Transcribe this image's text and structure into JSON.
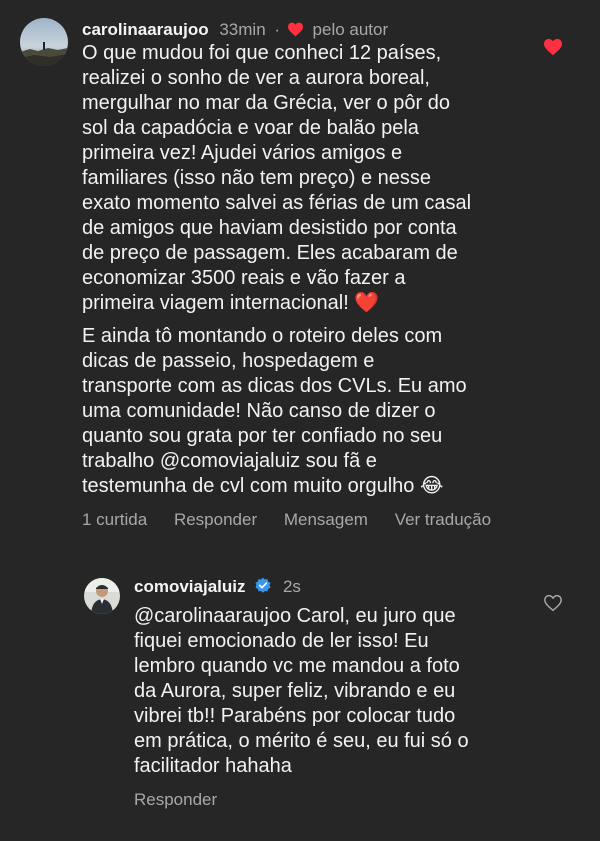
{
  "comment": {
    "username": "carolinaaraujoo",
    "time": "33min",
    "separator": "·",
    "liked_by_author": "pelo autor",
    "paragraph_1": "O que mudou foi que conheci 12 países,\nrealizei o sonho de ver a aurora boreal,\nmergulhar no mar da Grécia, ver o pôr do\nsol da capadócia e voar de balão pela\nprimeira vez! Ajudei vários amigos e\nfamiliares (isso não tem preço) e nesse\nexato momento salvei as férias de um casal\nde amigos que haviam desistido por conta\nde preço de passagem. Eles acabaram de\neconomizar 3500 reais e vão fazer a\nprimeira viagem internacional! ❤️",
    "paragraph_2": "E ainda tô montando o roteiro deles com\ndicas de passeio, hospedagem e\ntransporte com as dicas dos CVLs. Eu amo\numa comunidade! Não canso de dizer o\nquanto sou grata por ter confiado no seu\ntrabalho @comoviajaluiz sou fã e\ntestemunha de cvl com muito orgulho 😂",
    "actions": {
      "likes": "1 curtida",
      "reply": "Responder",
      "message": "Mensagem",
      "translate": "Ver tradução"
    },
    "liked": true,
    "heart_color": "#ff3040"
  },
  "reply": {
    "username": "comoviajaluiz",
    "time": "2s",
    "verified": true,
    "text": "@carolinaaraujoo Carol, eu juro que\nfiquei emocionado de ler isso! Eu\nlembro quando vc me mandou a foto\nda Aurora, super feliz, vibrando e eu\nvibrei tb!! Parabéns por colocar tudo\nem prática, o mérito é seu, eu fui só o\nfacilitador hahaha",
    "actions": {
      "reply": "Responder"
    },
    "liked": false,
    "verified_color": "#3797f0"
  }
}
